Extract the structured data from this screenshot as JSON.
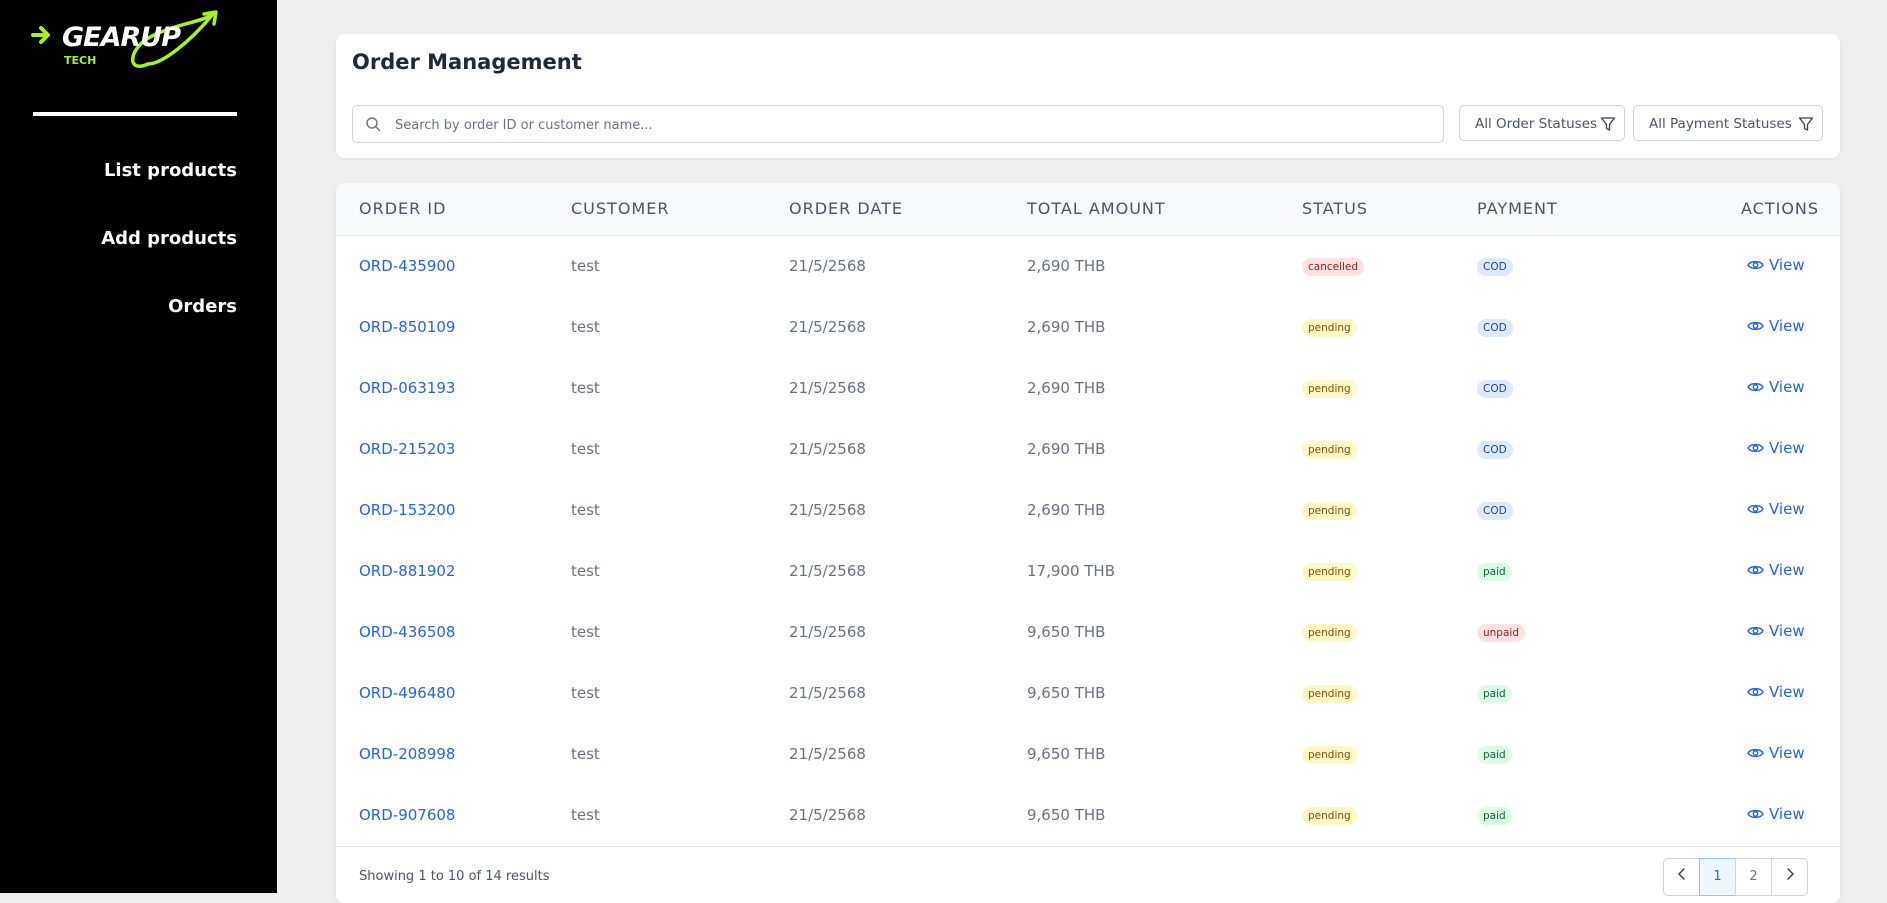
{
  "brand": {
    "name": "GEARUP",
    "sub": "TECH",
    "accent_color": "#a6f21b"
  },
  "sidebar": {
    "items": [
      {
        "label": "List products"
      },
      {
        "label": "Add products"
      },
      {
        "label": "Orders"
      }
    ]
  },
  "header": {
    "title": "Order Management",
    "search_placeholder": "Search by order ID or customer name...",
    "filter_order_status": "All Order Statuses",
    "filter_payment_status": "All Payment Statuses"
  },
  "table": {
    "columns": [
      "ORDER ID",
      "CUSTOMER",
      "ORDER DATE",
      "TOTAL AMOUNT",
      "STATUS",
      "PAYMENT",
      "ACTIONS"
    ],
    "action_label": "View",
    "rows": [
      {
        "id": "ORD-435900",
        "customer": "test",
        "date": "21/5/2568",
        "amount": "2,690 THB",
        "status": "cancelled",
        "payment": "COD"
      },
      {
        "id": "ORD-850109",
        "customer": "test",
        "date": "21/5/2568",
        "amount": "2,690 THB",
        "status": "pending",
        "payment": "COD"
      },
      {
        "id": "ORD-063193",
        "customer": "test",
        "date": "21/5/2568",
        "amount": "2,690 THB",
        "status": "pending",
        "payment": "COD"
      },
      {
        "id": "ORD-215203",
        "customer": "test",
        "date": "21/5/2568",
        "amount": "2,690 THB",
        "status": "pending",
        "payment": "COD"
      },
      {
        "id": "ORD-153200",
        "customer": "test",
        "date": "21/5/2568",
        "amount": "2,690 THB",
        "status": "pending",
        "payment": "COD"
      },
      {
        "id": "ORD-881902",
        "customer": "test",
        "date": "21/5/2568",
        "amount": "17,900 THB",
        "status": "pending",
        "payment": "paid"
      },
      {
        "id": "ORD-436508",
        "customer": "test",
        "date": "21/5/2568",
        "amount": "9,650 THB",
        "status": "pending",
        "payment": "unpaid"
      },
      {
        "id": "ORD-496480",
        "customer": "test",
        "date": "21/5/2568",
        "amount": "9,650 THB",
        "status": "pending",
        "payment": "paid"
      },
      {
        "id": "ORD-208998",
        "customer": "test",
        "date": "21/5/2568",
        "amount": "9,650 THB",
        "status": "pending",
        "payment": "paid"
      },
      {
        "id": "ORD-907608",
        "customer": "test",
        "date": "21/5/2568",
        "amount": "9,650 THB",
        "status": "pending",
        "payment": "paid"
      }
    ]
  },
  "footer": {
    "showing": "Showing 1 to 10 of 14 results",
    "pages": [
      "1",
      "2"
    ],
    "current_page": "1"
  }
}
